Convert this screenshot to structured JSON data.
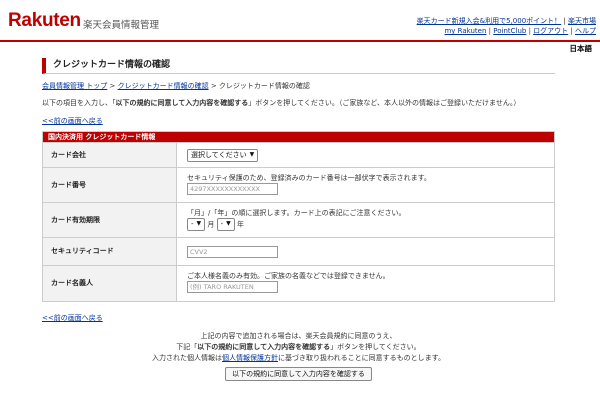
{
  "header": {
    "logo": "Rakuten",
    "site_title": "楽天会員情報管理",
    "links_line1": [
      "楽天カード新規入会&利用で5,000ポイント！",
      "楽天市場"
    ],
    "links_line2": [
      "my Rakuten",
      "PointClub",
      "ログアウト",
      "ヘルプ"
    ],
    "separator": "|",
    "language": "日本語"
  },
  "page": {
    "title": "クレジットカード情報の確認",
    "breadcrumb": [
      "会員情報管理 トップ",
      "クレジットカード情報の確認",
      "クレジットカード情報の確認"
    ],
    "breadcrumb_sep": ">",
    "intro_pre": "以下の項目を入力し、「",
    "intro_bold": "以下の規約に同意して入力内容を確認する",
    "intro_post": "」ボタンを押してください。（ご家族など、本人以外の情報はご登録いただけません。）",
    "back_link": "<<前の画面へ戻る"
  },
  "card_form": {
    "header": "国内決済用 クレジットカード情報",
    "rows": {
      "company": {
        "label": "カード会社",
        "select_value": "選択してください"
      },
      "number": {
        "label": "カード番号",
        "note": "セキュリティ保護のため、登録済みのカード番号は一部伏字で表示されます。",
        "placeholder": "4297XXXXXXXXXXXX"
      },
      "expiry": {
        "label": "カード有効期限",
        "note": "「月」/「年」の順に選択します。カード上の表記にご注意ください。",
        "month_value": "-",
        "month_unit": "月",
        "year_value": "-",
        "year_unit": "年"
      },
      "security": {
        "label": "セキュリティコード",
        "placeholder": "CVV2"
      },
      "holder": {
        "label": "カード名義人",
        "note": "ご本人様名義のみ有効。ご家族の名義などでは登録できません。",
        "placeholder": "(例) TARO RAKUTEN"
      }
    }
  },
  "footer": {
    "line1": "上記の内容で追加される場合は、楽天会員規約に同意のうえ、",
    "line2_pre": "下記「",
    "line2_bold": "以下の規約に同意して入力内容を確認する",
    "line2_post": "」ボタンを押してください。",
    "line3_pre": "入力された個人情報は",
    "line3_link": "個人情報保護方針",
    "line3_post": "に基づき取り扱われることに同意するものとします。",
    "submit_label": "以下の規約に同意して入力内容を確認する"
  }
}
